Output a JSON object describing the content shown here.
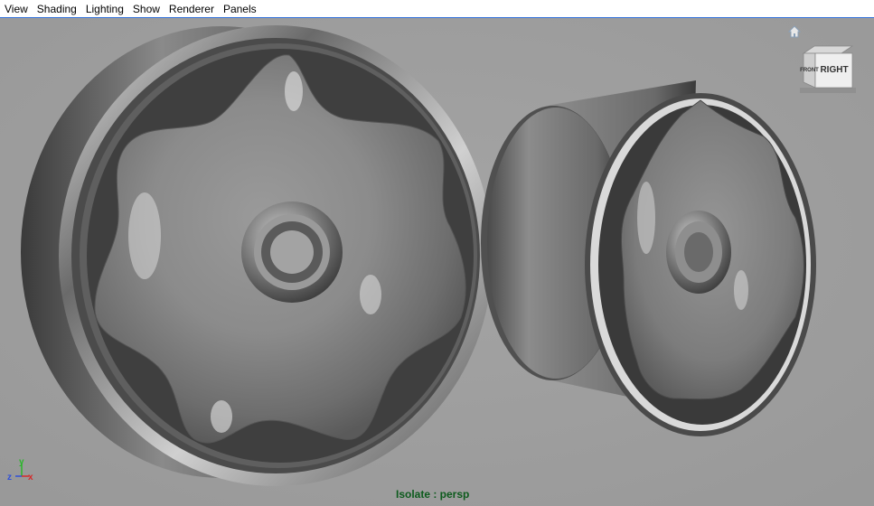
{
  "menu": {
    "items": [
      "View",
      "Shading",
      "Lighting",
      "Show",
      "Renderer",
      "Panels"
    ]
  },
  "viewcube": {
    "front_label": "FRONT",
    "right_label": "RIGHT"
  },
  "axis": {
    "y_label": "y",
    "z_label": "z",
    "x_label": "x"
  },
  "status": {
    "isolate_text": "Isolate : persp"
  },
  "colors": {
    "background": "#9f9f9f",
    "isolate_text": "#0d5b1d",
    "axis_x": "#d42a2a",
    "axis_y": "#2bb62b",
    "axis_z": "#2f4fd8"
  }
}
